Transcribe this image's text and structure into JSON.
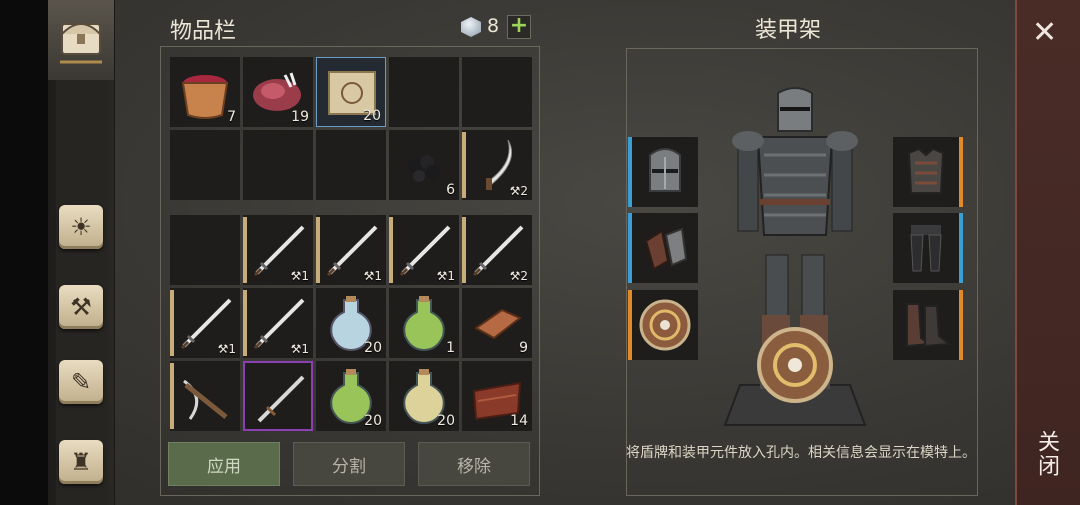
{
  "inventory": {
    "title": "物品栏",
    "currency_count": "8",
    "add_label": "+",
    "cells": [
      {
        "item": "berry-basket",
        "count": "7"
      },
      {
        "item": "raw-meat",
        "count": "19"
      },
      {
        "item": "scroll-map",
        "count": "20"
      },
      {
        "item": "",
        "count": ""
      },
      {
        "item": "",
        "count": ""
      },
      {
        "item": "",
        "count": ""
      },
      {
        "item": "",
        "count": ""
      },
      {
        "item": "",
        "count": ""
      },
      {
        "item": "coal",
        "count": "6"
      },
      {
        "item": "sickle",
        "count": "2"
      },
      {
        "item": "",
        "count": ""
      },
      {
        "item": "sword",
        "count": "1"
      },
      {
        "item": "sword",
        "count": "1"
      },
      {
        "item": "sword",
        "count": "1"
      },
      {
        "item": "sword",
        "count": "2"
      },
      {
        "item": "sword",
        "count": "1"
      },
      {
        "item": "sword",
        "count": "1"
      },
      {
        "item": "potion-blue",
        "count": "20"
      },
      {
        "item": "potion-green",
        "count": "1"
      },
      {
        "item": "copper-ingot",
        "count": "9"
      },
      {
        "item": "crossbow",
        "count": ""
      },
      {
        "item": "rare-sword",
        "count": ""
      },
      {
        "item": "potion-green",
        "count": "20"
      },
      {
        "item": "potion-yellow",
        "count": "20"
      },
      {
        "item": "jerky",
        "count": "14"
      }
    ],
    "buttons": {
      "apply": "应用",
      "split": "分割",
      "remove": "移除"
    }
  },
  "armor": {
    "title": "装甲架",
    "description": "将盾牌和装甲元件放入孔内。相关信息会显示在模特上。",
    "slots": [
      "helmet",
      "gloves",
      "shield",
      "chest-armor",
      "leg-armor",
      "boots"
    ]
  },
  "close": {
    "label": "关闭",
    "icon": "close-icon"
  },
  "colors": {
    "rare": "#3aa0d4",
    "epic": "#e08a2a",
    "purple": "#8a3fb3",
    "apply": "#5a6b4c"
  }
}
